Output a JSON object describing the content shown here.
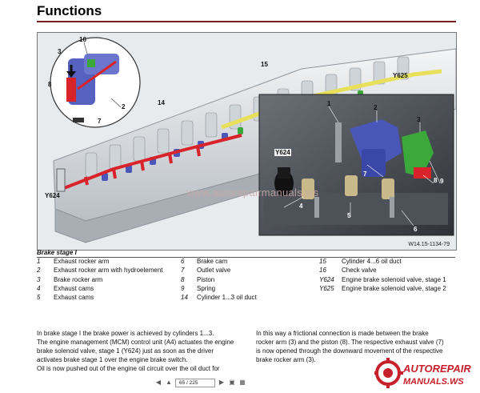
{
  "page_title": "Functions",
  "figure": {
    "code": "W14.15-1134-79",
    "watermark": "www.autorepairmanuals.ws",
    "callouts": {
      "c16": "16",
      "c3": "3",
      "c8": "8",
      "c2": "2",
      "c7": "7",
      "c14": "14",
      "c15": "15",
      "y625": "Y625",
      "y624_main": "Y624",
      "d1": "1",
      "d2": "2",
      "d3": "3",
      "y624_detail": "Y624",
      "d7": "7",
      "d8": "8",
      "d9": "9",
      "d4": "4",
      "d5": "5",
      "d6": "6"
    }
  },
  "legend": {
    "title": "Brake stage I",
    "col1": [
      {
        "num": "1",
        "label": "Exhaust rocker arm"
      },
      {
        "num": "2",
        "label": "Exhaust rocker arm with hydroelement"
      },
      {
        "num": "3",
        "label": "Brake rocker arm"
      },
      {
        "num": "4",
        "label": "Exhaust cams"
      },
      {
        "num": "5",
        "label": "Exhaust cams"
      }
    ],
    "col2": [
      {
        "num": "6",
        "label": "Brake cam"
      },
      {
        "num": "7",
        "label": "Outlet valve"
      },
      {
        "num": "8",
        "label": "Piston"
      },
      {
        "num": "9",
        "label": "Spring"
      },
      {
        "num": "14",
        "label": "Cylinder 1...3 oil duct"
      }
    ],
    "col3": [
      {
        "num": "15",
        "label": "Cylinder 4...6 oil duct"
      },
      {
        "num": "16",
        "label": "Check valve"
      },
      {
        "num": "Y624",
        "label": "Engine brake solenoid valve, stage 1"
      },
      {
        "num": "Y625",
        "label": "Engine brake solenoid valve, stage 2"
      }
    ]
  },
  "body": {
    "left": [
      "In brake stage I the brake power is achieved by cylinders 1...3.",
      "The engine management (MCM) control unit (A4) actuates the engine brake solenoid valve, stage 1 (Y624) just as soon as the driver activates brake stage 1 over the engine brake switch.",
      "Oil is now pushed out of the engine oil circuit over the oil duct for"
    ],
    "right": [
      "In this way a frictional connection is made between the brake rocker arm (3) and the piston (8). The respective exhaust valve (7) is now opened through the downward movement of the respective brake rocker arm (3)."
    ]
  },
  "toolbar": {
    "page_value": "65 / 225"
  },
  "logo": {
    "line1": "AUTOREPAIR",
    "line2": "MANUALS.WS",
    "color": "#c8202a"
  },
  "colors": {
    "accent_rule": "#7a1e1e",
    "oil_duct_red": "#d8232a",
    "oil_duct_yellow": "#e8e05a",
    "valve_blue": "#4a57b8",
    "valve_green": "#3aa83a"
  }
}
